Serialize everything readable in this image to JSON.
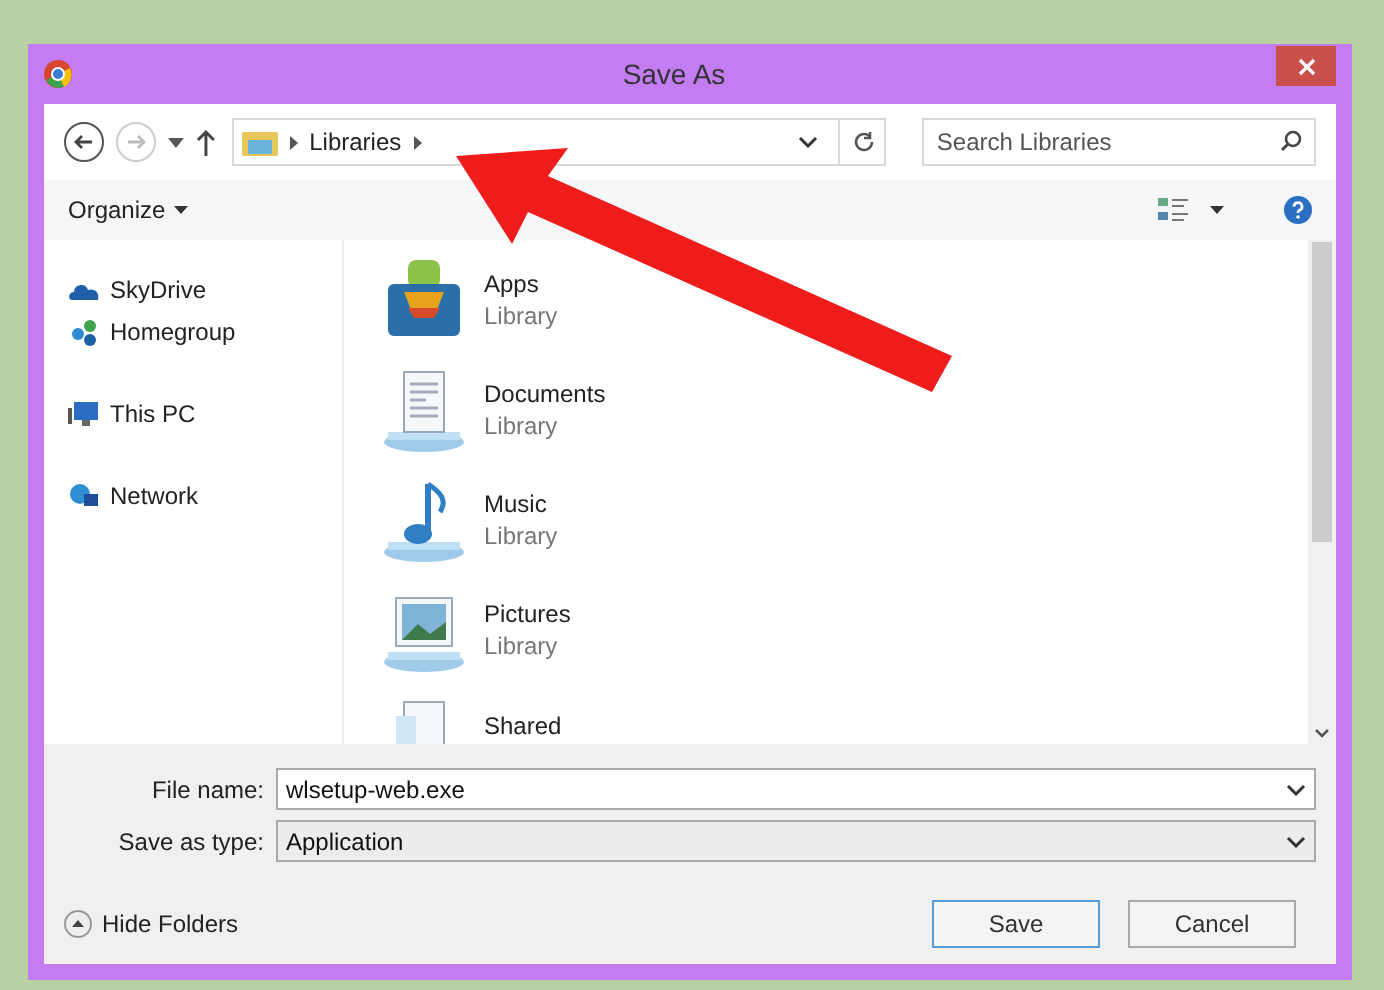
{
  "window": {
    "title": "Save As"
  },
  "navigation": {
    "back": {
      "disabled": false
    },
    "forward": {
      "disabled": true
    },
    "breadcrumb": [
      "Libraries"
    ],
    "search": {
      "placeholder": "Search Libraries"
    }
  },
  "toolbar": {
    "organize": "Organize"
  },
  "sidebar": {
    "items": [
      {
        "label": "SkyDrive",
        "kind": "cloud"
      },
      {
        "label": "Homegroup",
        "kind": "group"
      },
      {
        "label": "This PC",
        "kind": "pc"
      },
      {
        "label": "Network",
        "kind": "network"
      }
    ]
  },
  "libraries": [
    {
      "name": "Apps",
      "type": "Library",
      "kind": "apps"
    },
    {
      "name": "Documents",
      "type": "Library",
      "kind": "documents"
    },
    {
      "name": "Music",
      "type": "Library",
      "kind": "music"
    },
    {
      "name": "Pictures",
      "type": "Library",
      "kind": "pictures"
    },
    {
      "name": "Shared",
      "kind": "shared"
    }
  ],
  "form": {
    "file_name": {
      "label": "File name:",
      "value": "wlsetup-web.exe"
    },
    "save_as_type": {
      "label": "Save as type:",
      "value": "Application"
    }
  },
  "footer": {
    "hide_folders": "Hide Folders",
    "buttons": [
      "Save",
      "Cancel"
    ]
  }
}
